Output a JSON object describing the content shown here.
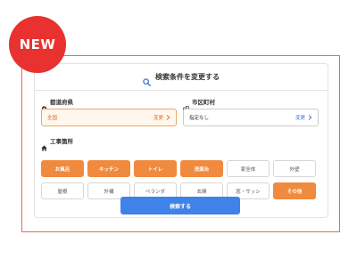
{
  "badge": {
    "text": "NEW"
  },
  "header": {
    "title": "検索条件を変更する",
    "icon": "search-icon"
  },
  "prefecture": {
    "label": "都道府県",
    "value": "全国",
    "change_label": "変更",
    "icon": "pin-icon"
  },
  "city": {
    "label": "市区町村",
    "value": "指定なし",
    "change_label": "変更",
    "icon": "building-icon"
  },
  "work_area": {
    "label": "工事箇所",
    "icon": "home-icon",
    "options": [
      {
        "label": "お風呂",
        "selected": true
      },
      {
        "label": "キッチン",
        "selected": true
      },
      {
        "label": "トイレ",
        "selected": true
      },
      {
        "label": "洗面台",
        "selected": true
      },
      {
        "label": "家全体",
        "selected": false
      },
      {
        "label": "外壁",
        "selected": false
      },
      {
        "label": "屋根",
        "selected": false
      },
      {
        "label": "外構",
        "selected": false
      },
      {
        "label": "ベランダ",
        "selected": false
      },
      {
        "label": "玄関",
        "selected": false
      },
      {
        "label": "窓・サッシ",
        "selected": false
      },
      {
        "label": "その他",
        "selected": true
      }
    ]
  },
  "search_button": {
    "label": "検索する"
  },
  "colors": {
    "accent_orange": "#f08a3f",
    "badge_red": "#e9312f",
    "button_blue": "#3f82e8",
    "link_blue": "#3a72d6"
  }
}
